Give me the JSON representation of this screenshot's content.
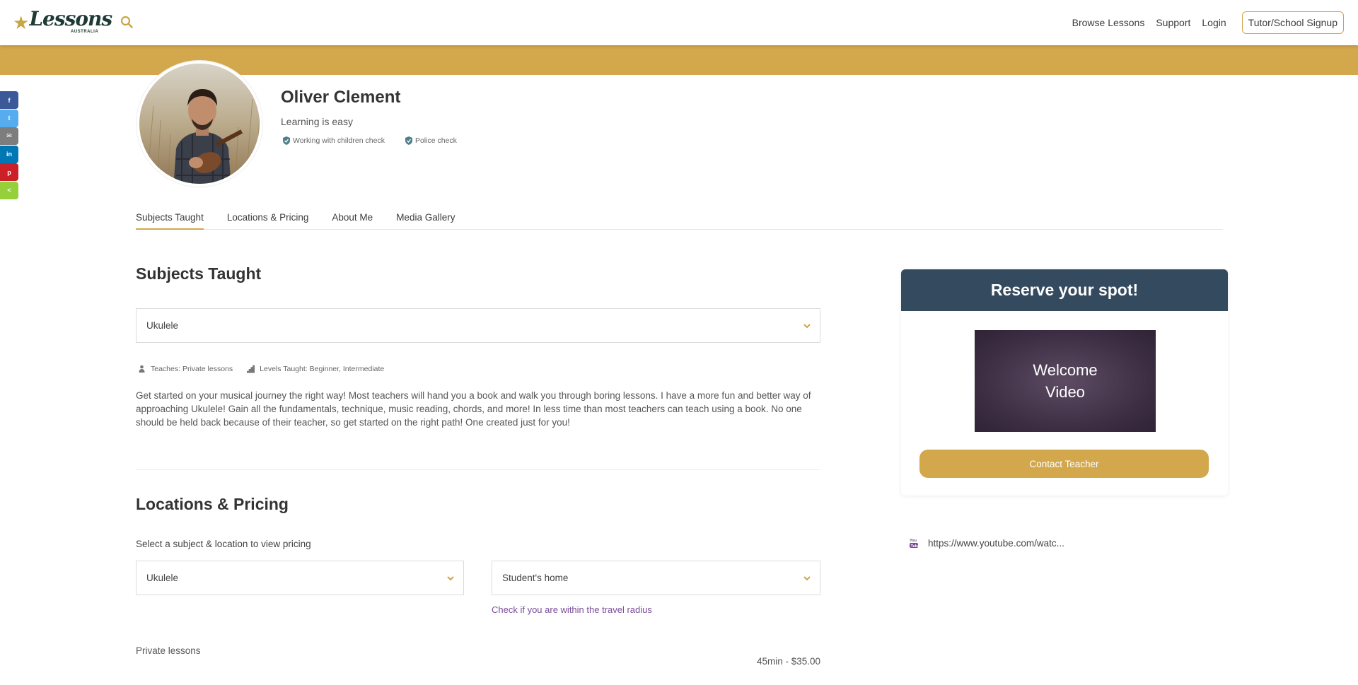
{
  "header": {
    "logo_text": "Lessons",
    "logo_sub": "AUSTRALIA",
    "nav": [
      "Browse Lessons",
      "Support",
      "Login"
    ],
    "signup_label": "Tutor/School Signup"
  },
  "social": [
    {
      "name": "facebook",
      "glyph": "f",
      "color": "#3b5998"
    },
    {
      "name": "twitter",
      "glyph": "t",
      "color": "#55acee"
    },
    {
      "name": "email",
      "glyph": "✉",
      "color": "#7d7d7d"
    },
    {
      "name": "linkedin",
      "glyph": "in",
      "color": "#0077b5"
    },
    {
      "name": "pinterest",
      "glyph": "p",
      "color": "#cb2027"
    },
    {
      "name": "share",
      "glyph": "<",
      "color": "#95d03a"
    }
  ],
  "profile": {
    "name": "Oliver Clement",
    "tagline": "Learning is easy",
    "checks": [
      "Working with children check",
      "Police check"
    ]
  },
  "tabs": [
    "Subjects Taught",
    "Locations & Pricing",
    "About Me",
    "Media Gallery"
  ],
  "subjects": {
    "title": "Subjects Taught",
    "selected": "Ukulele",
    "teaches": "Teaches: Private lessons",
    "levels": "Levels Taught: Beginner, Intermediate",
    "description": "Get started on your musical journey the right way! Most teachers will hand you a book and walk you through boring lessons. I have a more fun and better way of approaching Ukulele! Gain all the fundamentals, technique, music reading, chords, and more! In less time than most teachers can teach using a book. No one should be held back because of their teacher, so get started on the right path! One created just for you!"
  },
  "pricing": {
    "title": "Locations & Pricing",
    "prompt": "Select a subject & location to view pricing",
    "subject_selected": "Ukulele",
    "location_selected": "Student's home",
    "travel_link": "Check if you are within the travel radius",
    "lesson_type": "Private lessons",
    "price": "45min - $35.00"
  },
  "reserve": {
    "title": "Reserve your spot!",
    "video_line1": "Welcome",
    "video_line2": "Video",
    "contact_label": "Contact Teacher"
  },
  "youtube": {
    "url": "https://www.youtube.com/watc..."
  },
  "colors": {
    "accent_gold": "#d3a74c",
    "card_header": "#344a5e",
    "link_purple": "#7b4e99"
  }
}
